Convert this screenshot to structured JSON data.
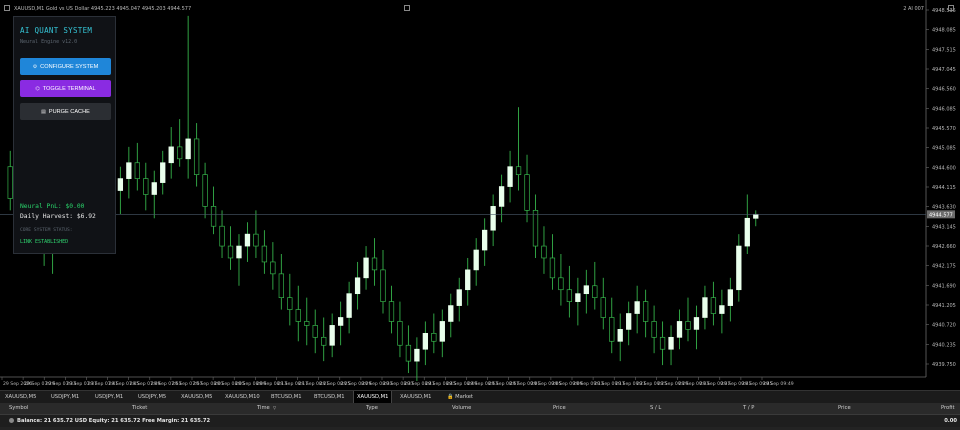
{
  "chart_window": {
    "title": "XAUUSD,M1  Gold vs US Dollar  4945.223 4945.047 4945.203 4944.577",
    "corner_text": "2  AI 007",
    "bid_tag": "4944.577",
    "price_axis": [
      "4948.535",
      "4948.085",
      "4947.515",
      "4947.045",
      "4946.560",
      "4946.085",
      "4945.570",
      "4945.085",
      "4944.600",
      "4944.115",
      "4943.630",
      "4943.145",
      "4942.660",
      "4942.175",
      "4941.690",
      "4941.205",
      "4940.720",
      "4940.235",
      "4939.750"
    ],
    "time_axis": [
      "29 Sep 2026",
      "29 Sep 07:29",
      "29 Sep 07:33",
      "29 Sep 07:37",
      "29 Sep 07:41",
      "29 Sep 07:45",
      "29 Sep 07:49",
      "29 Sep 07:53",
      "29 Sep 07:57",
      "29 Sep 08:01",
      "29 Sep 08:05",
      "29 Sep 08:09",
      "29 Sep 08:13",
      "29 Sep 08:17",
      "29 Sep 08:21",
      "29 Sep 08:25",
      "29 Sep 08:29",
      "29 Sep 08:33",
      "29 Sep 08:37",
      "29 Sep 08:41",
      "29 Sep 08:45",
      "29 Sep 08:49",
      "29 Sep 08:53",
      "29 Sep 08:57",
      "29 Sep 09:01",
      "29 Sep 09:05",
      "29 Sep 09:09",
      "29 Sep 09:13",
      "29 Sep 09:17",
      "29 Sep 09:21",
      "29 Sep 09:25",
      "29 Sep 09:29",
      "29 Sep 09:33",
      "29 Sep 09:37",
      "29 Sep 09:41",
      "29 Sep 09:45",
      "29 Sep 09:49"
    ],
    "colors": {
      "bull_body": "#e9ffec",
      "wick": "#35b24a",
      "bid_line": "#4a5a6a"
    }
  },
  "chart_data": {
    "type": "candlestick",
    "symbol": "XAUUSD",
    "timeframe": "M1",
    "ylim": [
      4939.6,
      4948.9
    ],
    "candles": [
      {
        "o": 4944.9,
        "h": 4945.3,
        "l": 4943.8,
        "c": 4944.1
      },
      {
        "o": 4944.3,
        "h": 4944.7,
        "l": 4943.5,
        "c": 4944.0
      },
      {
        "o": 4944.0,
        "h": 4944.5,
        "l": 4943.2,
        "c": 4943.6
      },
      {
        "o": 4943.6,
        "h": 4944.0,
        "l": 4942.8,
        "c": 4943.1
      },
      {
        "o": 4943.1,
        "h": 4943.5,
        "l": 4942.4,
        "c": 4942.8
      },
      {
        "o": 4942.8,
        "h": 4943.6,
        "l": 4942.2,
        "c": 4943.3
      },
      {
        "o": 4943.3,
        "h": 4944.2,
        "l": 4942.9,
        "c": 4943.9
      },
      {
        "o": 4943.9,
        "h": 4944.6,
        "l": 4943.4,
        "c": 4944.3
      },
      {
        "o": 4944.3,
        "h": 4945.6,
        "l": 4943.9,
        "c": 4945.2
      },
      {
        "o": 4945.2,
        "h": 4946.2,
        "l": 4944.7,
        "c": 4945.8
      },
      {
        "o": 4945.8,
        "h": 4946.4,
        "l": 4944.6,
        "c": 4945.1
      },
      {
        "o": 4945.1,
        "h": 4945.7,
        "l": 4944.4,
        "c": 4944.8
      },
      {
        "o": 4944.8,
        "h": 4945.3,
        "l": 4944.0,
        "c": 4944.3
      },
      {
        "o": 4944.3,
        "h": 4944.9,
        "l": 4943.7,
        "c": 4944.6
      },
      {
        "o": 4944.6,
        "h": 4945.4,
        "l": 4944.1,
        "c": 4945.0
      },
      {
        "o": 4945.0,
        "h": 4945.5,
        "l": 4944.3,
        "c": 4944.6
      },
      {
        "o": 4944.6,
        "h": 4945.0,
        "l": 4943.8,
        "c": 4944.2
      },
      {
        "o": 4944.2,
        "h": 4944.8,
        "l": 4943.6,
        "c": 4944.5
      },
      {
        "o": 4944.5,
        "h": 4945.3,
        "l": 4944.2,
        "c": 4945.0
      },
      {
        "o": 4945.0,
        "h": 4945.9,
        "l": 4944.6,
        "c": 4945.4
      },
      {
        "o": 4945.4,
        "h": 4946.1,
        "l": 4944.9,
        "c": 4945.1
      },
      {
        "o": 4945.1,
        "h": 4948.7,
        "l": 4944.6,
        "c": 4945.6
      },
      {
        "o": 4945.6,
        "h": 4946.0,
        "l": 4944.4,
        "c": 4944.7
      },
      {
        "o": 4944.7,
        "h": 4945.0,
        "l": 4943.6,
        "c": 4943.9
      },
      {
        "o": 4943.9,
        "h": 4944.4,
        "l": 4943.2,
        "c": 4943.4
      },
      {
        "o": 4943.4,
        "h": 4943.8,
        "l": 4942.6,
        "c": 4942.9
      },
      {
        "o": 4942.9,
        "h": 4943.4,
        "l": 4942.3,
        "c": 4942.6
      },
      {
        "o": 4942.6,
        "h": 4943.2,
        "l": 4941.9,
        "c": 4942.9
      },
      {
        "o": 4942.9,
        "h": 4943.5,
        "l": 4942.5,
        "c": 4943.2
      },
      {
        "o": 4943.2,
        "h": 4943.8,
        "l": 4942.6,
        "c": 4942.9
      },
      {
        "o": 4942.9,
        "h": 4943.3,
        "l": 4942.2,
        "c": 4942.5
      },
      {
        "o": 4942.5,
        "h": 4943.0,
        "l": 4941.8,
        "c": 4942.2
      },
      {
        "o": 4942.2,
        "h": 4942.7,
        "l": 4941.3,
        "c": 4941.6
      },
      {
        "o": 4941.6,
        "h": 4942.2,
        "l": 4940.9,
        "c": 4941.3
      },
      {
        "o": 4941.3,
        "h": 4941.9,
        "l": 4940.5,
        "c": 4941.0
      },
      {
        "o": 4941.0,
        "h": 4941.6,
        "l": 4940.4,
        "c": 4940.9
      },
      {
        "o": 4940.9,
        "h": 4941.3,
        "l": 4940.2,
        "c": 4940.6
      },
      {
        "o": 4940.6,
        "h": 4941.1,
        "l": 4940.0,
        "c": 4940.4
      },
      {
        "o": 4940.4,
        "h": 4941.2,
        "l": 4940.1,
        "c": 4940.9
      },
      {
        "o": 4940.9,
        "h": 4941.5,
        "l": 4940.4,
        "c": 4941.1
      },
      {
        "o": 4941.1,
        "h": 4942.0,
        "l": 4940.7,
        "c": 4941.7
      },
      {
        "o": 4941.7,
        "h": 4942.5,
        "l": 4941.3,
        "c": 4942.1
      },
      {
        "o": 4942.1,
        "h": 4942.9,
        "l": 4941.8,
        "c": 4942.6
      },
      {
        "o": 4942.6,
        "h": 4943.1,
        "l": 4941.9,
        "c": 4942.3
      },
      {
        "o": 4942.3,
        "h": 4942.8,
        "l": 4941.2,
        "c": 4941.5
      },
      {
        "o": 4941.5,
        "h": 4941.9,
        "l": 4940.7,
        "c": 4941.0
      },
      {
        "o": 4941.0,
        "h": 4941.5,
        "l": 4940.1,
        "c": 4940.4
      },
      {
        "o": 4940.4,
        "h": 4940.9,
        "l": 4939.7,
        "c": 4940.0
      },
      {
        "o": 4940.0,
        "h": 4940.6,
        "l": 4939.5,
        "c": 4940.3
      },
      {
        "o": 4940.3,
        "h": 4941.0,
        "l": 4939.9,
        "c": 4940.7
      },
      {
        "o": 4940.7,
        "h": 4941.2,
        "l": 4940.2,
        "c": 4940.5
      },
      {
        "o": 4940.5,
        "h": 4941.3,
        "l": 4940.1,
        "c": 4941.0
      },
      {
        "o": 4941.0,
        "h": 4941.7,
        "l": 4940.6,
        "c": 4941.4
      },
      {
        "o": 4941.4,
        "h": 4942.1,
        "l": 4941.0,
        "c": 4941.8
      },
      {
        "o": 4941.8,
        "h": 4942.6,
        "l": 4941.4,
        "c": 4942.3
      },
      {
        "o": 4942.3,
        "h": 4943.1,
        "l": 4941.9,
        "c": 4942.8
      },
      {
        "o": 4942.8,
        "h": 4943.6,
        "l": 4942.4,
        "c": 4943.3
      },
      {
        "o": 4943.3,
        "h": 4944.2,
        "l": 4942.9,
        "c": 4943.9
      },
      {
        "o": 4943.9,
        "h": 4944.7,
        "l": 4943.5,
        "c": 4944.4
      },
      {
        "o": 4944.4,
        "h": 4945.3,
        "l": 4944.0,
        "c": 4944.9
      },
      {
        "o": 4944.9,
        "h": 4946.4,
        "l": 4944.3,
        "c": 4944.7
      },
      {
        "o": 4944.7,
        "h": 4945.2,
        "l": 4943.5,
        "c": 4943.8
      },
      {
        "o": 4943.8,
        "h": 4944.2,
        "l": 4942.6,
        "c": 4942.9
      },
      {
        "o": 4942.9,
        "h": 4943.4,
        "l": 4942.2,
        "c": 4942.6
      },
      {
        "o": 4942.6,
        "h": 4943.2,
        "l": 4941.8,
        "c": 4942.1
      },
      {
        "o": 4942.1,
        "h": 4942.7,
        "l": 4941.4,
        "c": 4941.8
      },
      {
        "o": 4941.8,
        "h": 4942.4,
        "l": 4941.1,
        "c": 4941.5
      },
      {
        "o": 4941.5,
        "h": 4942.1,
        "l": 4940.9,
        "c": 4941.7
      },
      {
        "o": 4941.7,
        "h": 4942.3,
        "l": 4941.2,
        "c": 4941.9
      },
      {
        "o": 4941.9,
        "h": 4942.5,
        "l": 4941.3,
        "c": 4941.6
      },
      {
        "o": 4941.6,
        "h": 4942.1,
        "l": 4940.8,
        "c": 4941.1
      },
      {
        "o": 4941.1,
        "h": 4941.6,
        "l": 4940.2,
        "c": 4940.5
      },
      {
        "o": 4940.5,
        "h": 4941.2,
        "l": 4940.0,
        "c": 4940.8
      },
      {
        "o": 4940.8,
        "h": 4941.5,
        "l": 4940.4,
        "c": 4941.2
      },
      {
        "o": 4941.2,
        "h": 4941.9,
        "l": 4940.7,
        "c": 4941.5
      },
      {
        "o": 4941.5,
        "h": 4941.8,
        "l": 4940.6,
        "c": 4941.0
      },
      {
        "o": 4941.0,
        "h": 4941.4,
        "l": 4940.2,
        "c": 4940.6
      },
      {
        "o": 4940.6,
        "h": 4941.0,
        "l": 4939.9,
        "c": 4940.3
      },
      {
        "o": 4940.3,
        "h": 4940.9,
        "l": 4939.9,
        "c": 4940.6
      },
      {
        "o": 4940.6,
        "h": 4941.3,
        "l": 4940.3,
        "c": 4941.0
      },
      {
        "o": 4941.0,
        "h": 4941.6,
        "l": 4940.5,
        "c": 4940.8
      },
      {
        "o": 4940.8,
        "h": 4941.4,
        "l": 4940.3,
        "c": 4941.1
      },
      {
        "o": 4941.1,
        "h": 4941.9,
        "l": 4940.8,
        "c": 4941.6
      },
      {
        "o": 4941.6,
        "h": 4942.0,
        "l": 4940.9,
        "c": 4941.2
      },
      {
        "o": 4941.2,
        "h": 4941.8,
        "l": 4940.7,
        "c": 4941.4
      },
      {
        "o": 4941.4,
        "h": 4942.1,
        "l": 4941.0,
        "c": 4941.8
      },
      {
        "o": 4941.8,
        "h": 4943.2,
        "l": 4941.5,
        "c": 4942.9
      },
      {
        "o": 4942.9,
        "h": 4944.2,
        "l": 4942.7,
        "c": 4943.6
      },
      {
        "o": 4943.6,
        "h": 4943.8,
        "l": 4943.4,
        "c": 4943.7
      }
    ]
  },
  "quant_panel": {
    "title": "AI QUANT SYSTEM",
    "subtitle": "Neural Engine v12.0",
    "btn_configure": "CONFIGURE SYSTEM",
    "btn_toggle": "TOGGLE TERMINAL",
    "btn_purge": "PURGE CACHE",
    "pnl": "Neural PnL: $0.00",
    "harvest": "Daily Harvest: $6.92",
    "status_label": "CORE SYSTEM STATUS:",
    "status_value": "LINK ESTABLISHED",
    "colors": {
      "accent": "#35c4d6",
      "config": "#1f86d9",
      "toggle": "#8a2be2",
      "ok": "#29d36a"
    }
  },
  "tabs": [
    "XAUUSD,M5",
    "USDJPY,M1",
    "USDJPY,M1",
    "USDJPY,M5",
    "XAUUSD,M5",
    "XAUUSD,M10",
    "BTCUSD,M1",
    "BTCUSD,M1",
    "XAUUSD,M1",
    "XAUUSD,M1",
    "Market"
  ],
  "toolbox": {
    "columns": [
      "Symbol",
      "Ticket",
      "Time",
      "Type",
      "Volume",
      "Price",
      "S / L",
      "T / P",
      "Price",
      "Profit"
    ],
    "balance_line": "Balance: 21 635.72 USD  Equity: 21 635.72  Free Margin: 21 635.72",
    "profit": "0.00"
  }
}
